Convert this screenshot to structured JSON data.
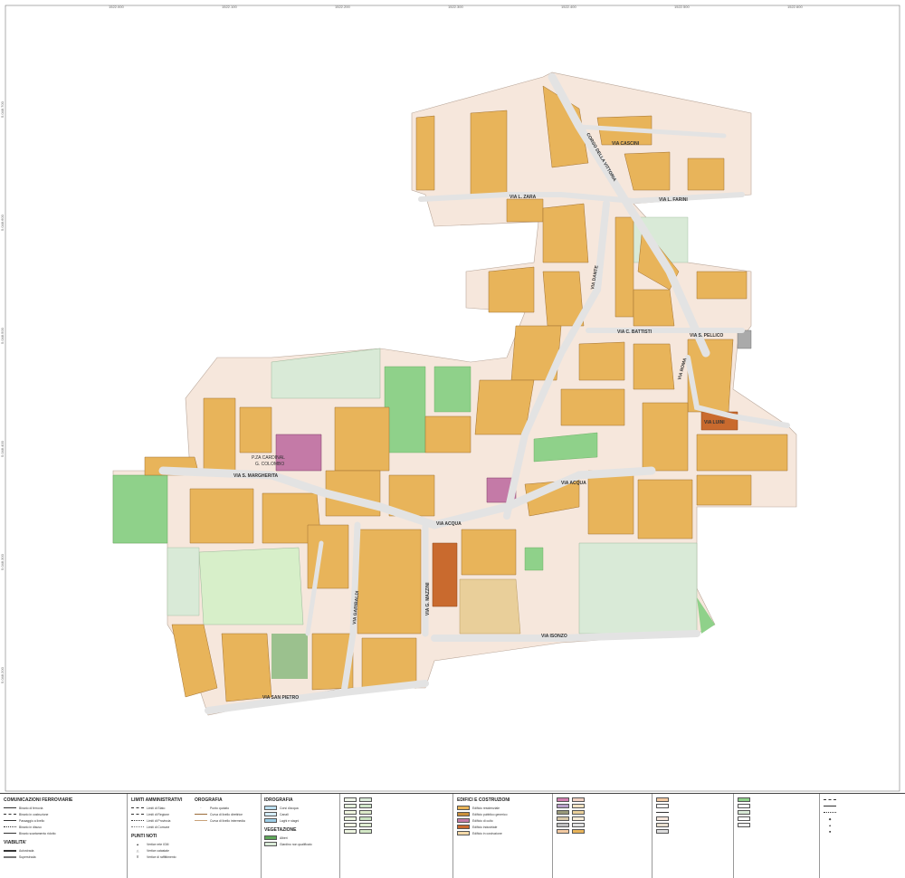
{
  "map": {
    "top_coords": [
      "1522.000",
      "1522.100",
      "1522.200",
      "1522.300",
      "1522.400",
      "1522.500",
      "1522.600"
    ],
    "side_coords": [
      "5.048.700",
      "5.048.600",
      "5.048.500",
      "5.048.400",
      "5.048.300",
      "5.048.200"
    ],
    "streets": {
      "via_cascini": "VIA CASCINI",
      "corso": "CORSO DELLA VITTORIA",
      "via_zara": "VIA L. ZARA",
      "via_farini": "VIA L. FARINI",
      "via_dante": "VIA DANTE",
      "via_battisti": "VIA C. BATTISTI",
      "via_pellico": "VIA S. PELLICO",
      "via_luini": "VIA LUINI",
      "via_margherita": "VIA S. MARGHERITA",
      "via_acqua": "VIA ACQUA",
      "via_acqua2": "VIA ACQUA",
      "via_mazzini": "VIA G. MAZZINI",
      "via_sampietro": "VIA SAN PIETRO",
      "via_isonzo": "VIA ISONZO",
      "via_garibaldi": "VIA GARIBALDI",
      "via_roma": "VIA ROMA",
      "piazza_1": "P.ZA CARDINAL",
      "piazza_2": "G. COLOMBO"
    }
  },
  "legend": {
    "sections": [
      {
        "title": "COMUNICAZIONI FERROVIARIE",
        "items": [
          "Binario di ferrovia",
          "Binario in costruzione",
          "Passaggio a livello",
          "Binario in disuso",
          "Binario scartamento ridotto"
        ]
      },
      {
        "title": "VIABILITA'",
        "items": [
          "Autostrada",
          "Superstrada"
        ]
      },
      {
        "title": "LIMITI AMMINISTRATIVI",
        "items": [
          "Limiti di Stato",
          "Limiti di Regione",
          "Limiti di Provincia",
          "Limiti di Comune"
        ]
      },
      {
        "title": "PUNTI NOTI",
        "items": [
          "Vertice rete IGM",
          "Vertice catastale",
          "Vertice di raffittimento"
        ]
      },
      {
        "title": "OROGRAFIA",
        "items": [
          "Punto quotato",
          "Curva di livello direttrice",
          "Curva di livello intermedia"
        ]
      },
      {
        "title": "IDROGRAFIA",
        "items": [
          "Corsi d'acqua",
          "Canali",
          "Laghi e stagni"
        ]
      },
      {
        "title": "VEGETAZIONE",
        "items": [
          "Alberi",
          "Giardino non qualificato"
        ]
      },
      {
        "title": "EDIFICI E COSTRUZIONI",
        "items": [
          "Edificio residenziale",
          "Edificio pubblico generico",
          "Edificio di culto",
          "Edificio industriale",
          "Edificio in costruzione"
        ]
      }
    ]
  },
  "colors": {
    "building": "#e8b45a",
    "building_dark": "#c98f3a",
    "yard": "#f6e7dc",
    "road": "#e3e3e3",
    "green_light": "#d9ead7",
    "green": "#8fd18a",
    "green_dark": "#5fa85a",
    "church": "#c47aa7",
    "industrial": "#c96a2e",
    "sand": "#e9cf9a"
  }
}
